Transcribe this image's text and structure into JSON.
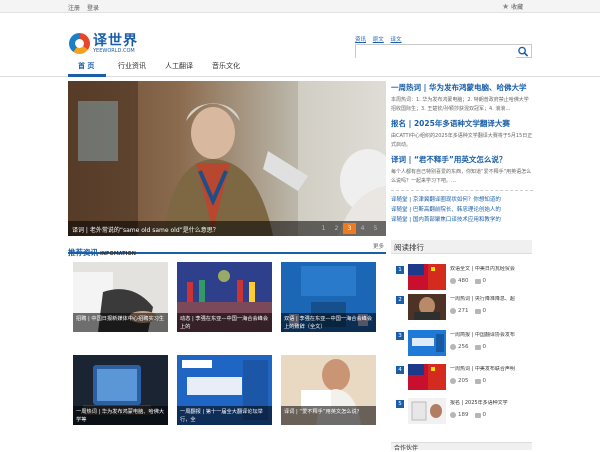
{
  "topbar": {
    "register": "注册",
    "login": "登录",
    "favorite": "收藏"
  },
  "logo": {
    "cn": "译世界",
    "en": "YEEWORLD.COM"
  },
  "search": {
    "links": [
      "资讯",
      "原文",
      "译文"
    ],
    "placeholder": ""
  },
  "nav": {
    "items": [
      "首 页",
      "行业资讯",
      "人工翻译",
      "音乐文化"
    ]
  },
  "hero": {
    "caption": "译词 | 老外常说的“same old same old”是什么意思？",
    "pages": [
      "1",
      "2",
      "3",
      "4",
      "5"
    ],
    "active_page": "3"
  },
  "hot": {
    "blocks": [
      {
        "title": "一周热词 | 华为发布鸿蒙电脑、哈佛大学",
        "text": "本周热词：1. 华为发布鸿蒙电脑；2. 特朗普政府禁止哈佛大学招收国际生；3. 王楚钦/孙颖莎获混双冠军；4. 浪浪…"
      },
      {
        "title": "报名 | 2025年多语种文学翻译大赛",
        "text": "由CATTI中心组织的2025年多语种文学翻译大赛将于5月15日正式启动。"
      },
      {
        "title": "译词 | “君不释手”用英文怎么说？",
        "text": "每个人都有自己特别喜爱的东西，你知道“爱不释手”用英语怎么么说吗？一起来学习下吧。…"
      }
    ],
    "links": [
      "译随堂 | 京津冀翻译圈现状如何？你想知道的",
      "译随堂 | 巴斯高翻前院长、韩忠理论创始人的",
      "译随堂 | 国内首部聚焦口译技术应用和教学的"
    ]
  },
  "recommend": {
    "title": "推荐资讯",
    "subtitle": "INFOMATION",
    "more": "更多",
    "cards": [
      {
        "caption": "招聘 | 中国日报新媒体中心招聘实习生"
      },
      {
        "caption": "动态 | 李强在东亚—中国一海合会峰会上的"
      },
      {
        "caption": "双语 | 李强在东亚—中国一海合会峰会上的致辞（全文）"
      },
      {
        "caption": "一周热词 | 华为发布鸿蒙电脑、哈佛大学等"
      },
      {
        "caption": "一周翻报 | 第十一届全大翻译论坛举行，全"
      },
      {
        "caption": "译词 | “爱不释手”用英文怎么说？"
      }
    ]
  },
  "ranking": {
    "title": "阅读排行",
    "items": [
      {
        "num": "1",
        "title": "双语全文 | 中美日内瓦经贸会",
        "views": "480",
        "comments": "0"
      },
      {
        "num": "2",
        "title": "一周热词 | 央行降准降息、超",
        "views": "271",
        "comments": "0"
      },
      {
        "num": "3",
        "title": "一周简报 | 中国翻译协会发布",
        "views": "256",
        "comments": "0"
      },
      {
        "num": "4",
        "title": "一周热词 | 中美发布联合声明",
        "views": "205",
        "comments": "0"
      },
      {
        "num": "5",
        "title": "报名 | 2025年多语种文学",
        "views": "189",
        "comments": "0"
      }
    ]
  },
  "bottom": {
    "title": "合作伙伴"
  }
}
